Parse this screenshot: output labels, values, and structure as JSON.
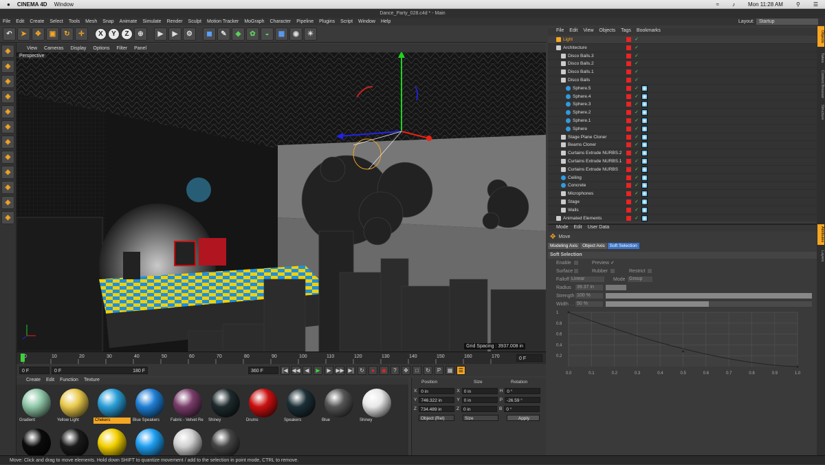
{
  "mac": {
    "app": "CINEMA 4D",
    "menu": "Window",
    "clock": "Mon 11:28 AM"
  },
  "window_title": "Dance_Party_028.c4d * - Main",
  "menu": [
    "File",
    "Edit",
    "Create",
    "Select",
    "Tools",
    "Mesh",
    "Snap",
    "Animate",
    "Simulate",
    "Render",
    "Sculpt",
    "Motion Tracker",
    "MoGraph",
    "Character",
    "Pipeline",
    "Plugins",
    "Script",
    "Window",
    "Help"
  ],
  "layout": {
    "label": "Layout:",
    "value": "Startup"
  },
  "toolbar_icons": [
    "undo-icon",
    "live-select-icon",
    "move-icon",
    "scale-icon",
    "rotate-icon",
    "last-tool-icon",
    "x-axis-icon",
    "y-axis-icon",
    "z-axis-icon",
    "world-coord-icon",
    "render-view-icon",
    "render-picture-viewer-icon",
    "edit-render-settings-icon",
    "cube-icon",
    "pen-icon",
    "subdivision-icon",
    "array-icon",
    "deformer-icon",
    "floor-icon",
    "camera-icon",
    "light-icon"
  ],
  "viewport": {
    "menu": [
      "View",
      "Cameras",
      "Display",
      "Options",
      "Filter",
      "Panel"
    ],
    "label": "Perspective",
    "grid_spacing": "Grid Spacing : 3937.008 in"
  },
  "timeline": {
    "ticks": [
      "0",
      "10",
      "20",
      "30",
      "40",
      "50",
      "60",
      "70",
      "80",
      "90",
      "100",
      "110",
      "120",
      "130",
      "140",
      "150",
      "160",
      "170"
    ],
    "end_label": "0 F"
  },
  "playback": {
    "start": "0 F",
    "range": "0 F",
    "range_end": "180 F",
    "end": "360 F"
  },
  "materials": {
    "menu": [
      "Create",
      "Edit",
      "Function",
      "Texture"
    ],
    "items": [
      {
        "name": "Gradient",
        "color": "#8fc7a8"
      },
      {
        "name": "Yellow Light",
        "color": "#e8c84a"
      },
      {
        "name": "Chekers",
        "color": "#2a9fd8",
        "selected": true
      },
      {
        "name": "Blue Speakers",
        "color": "#1f7fd6"
      },
      {
        "name": "Fabric - Velvet Re",
        "color": "#7a3d6a"
      },
      {
        "name": "Shiney",
        "color": "#1e2a2c"
      },
      {
        "name": "Drums",
        "color": "#cc1010"
      },
      {
        "name": "Speakers",
        "color": "#1c2f36"
      },
      {
        "name": "Blue",
        "color": "#555555"
      },
      {
        "name": "Shiney",
        "color": "#e8e8e8"
      }
    ],
    "row2": [
      "#0b0b0b",
      "#1a1a1a",
      "#f2d000",
      "#1e9ef0",
      "#cfcfcf",
      "#444444"
    ]
  },
  "coords": {
    "headers": [
      "Position",
      "Size",
      "Rotation"
    ],
    "x": {
      "pos": "0 in",
      "size": "0 in",
      "rot": "0 °"
    },
    "y": {
      "pos": "746.322 in",
      "size": "0 in",
      "rot": "-26.59 °"
    },
    "z": {
      "pos": "734.489 in",
      "size": "0 in",
      "rot": "0 °"
    },
    "mode": "Object (Rel)",
    "size_mode": "Size",
    "apply": "Apply",
    "labels": {
      "H": "H",
      "P": "P",
      "B": "B",
      "X": "X",
      "Y": "Y",
      "Z": "Z"
    }
  },
  "objects": {
    "menu": [
      "File",
      "Edit",
      "View",
      "Objects",
      "Tags",
      "Bookmarks"
    ],
    "rows": [
      {
        "name": "Light",
        "indent": 0,
        "color": "#f5a623",
        "highlight": true
      },
      {
        "name": "Architecture",
        "indent": 0
      },
      {
        "name": "Disco Balls.3",
        "indent": 1
      },
      {
        "name": "Disco Balls.2",
        "indent": 1
      },
      {
        "name": "Disco Balls.1",
        "indent": 1
      },
      {
        "name": "Disco Balls",
        "indent": 1
      },
      {
        "name": "Sphere.5",
        "indent": 2,
        "sphere": true
      },
      {
        "name": "Sphere.4",
        "indent": 2,
        "sphere": true
      },
      {
        "name": "Sphere.3",
        "indent": 2,
        "sphere": true
      },
      {
        "name": "Sphere.2",
        "indent": 2,
        "sphere": true
      },
      {
        "name": "Sphere.1",
        "indent": 2,
        "sphere": true
      },
      {
        "name": "Sphere",
        "indent": 2,
        "sphere": true
      },
      {
        "name": "Stage Plane Cloner",
        "indent": 1
      },
      {
        "name": "Beams Cloner",
        "indent": 1
      },
      {
        "name": "Curtains Extrude NURBS.2",
        "indent": 1
      },
      {
        "name": "Curtains Extrude NURBS.1",
        "indent": 1
      },
      {
        "name": "Curtains Extrude NURBS",
        "indent": 1
      },
      {
        "name": "Ceiling",
        "indent": 1,
        "sphere": true
      },
      {
        "name": "Concrete",
        "indent": 1,
        "sphere": true
      },
      {
        "name": "Microphones",
        "indent": 1
      },
      {
        "name": "Stage",
        "indent": 1
      },
      {
        "name": "Walls",
        "indent": 1
      },
      {
        "name": "Animated Elements",
        "indent": 0
      }
    ]
  },
  "attributes": {
    "menu": [
      "Mode",
      "Edit",
      "User Data"
    ],
    "tool": "Move",
    "tabs": [
      "Modeling Axis",
      "Object Axis",
      "Soft Selection"
    ],
    "active_tab": "Soft Selection",
    "section": "Soft Selection",
    "enable": "Enable",
    "preview": "Preview",
    "surface": "Surface",
    "rubber": "Rubber",
    "restrict": "Restrict",
    "falloff": "Falloff",
    "falloff_val": "Linear",
    "mode": "Mode",
    "mode_val": "Group",
    "radius": "Radius",
    "radius_val": "39.37 in",
    "strength": "Strength",
    "strength_val": "100 %",
    "width": "Width . .",
    "width_val": "50 %",
    "strength_fill": 1.0,
    "width_fill": 0.5,
    "curve_x": [
      "0.0",
      "0.1",
      "0.2",
      "0.3",
      "0.4",
      "0.5",
      "0.6",
      "0.7",
      "0.8",
      "0.9",
      "1.0"
    ],
    "curve_y": [
      "1",
      "0.8",
      "0.6",
      "0.4",
      "0.2"
    ]
  },
  "side_tabs": [
    "Objects",
    "Takes",
    "Content Browser",
    "Structure",
    "Attributes",
    "Layers"
  ],
  "status": "Move: Click and drag to move elements. Hold down SHIFT to quantize movement / add to the selection in point mode, CTRL to remove."
}
